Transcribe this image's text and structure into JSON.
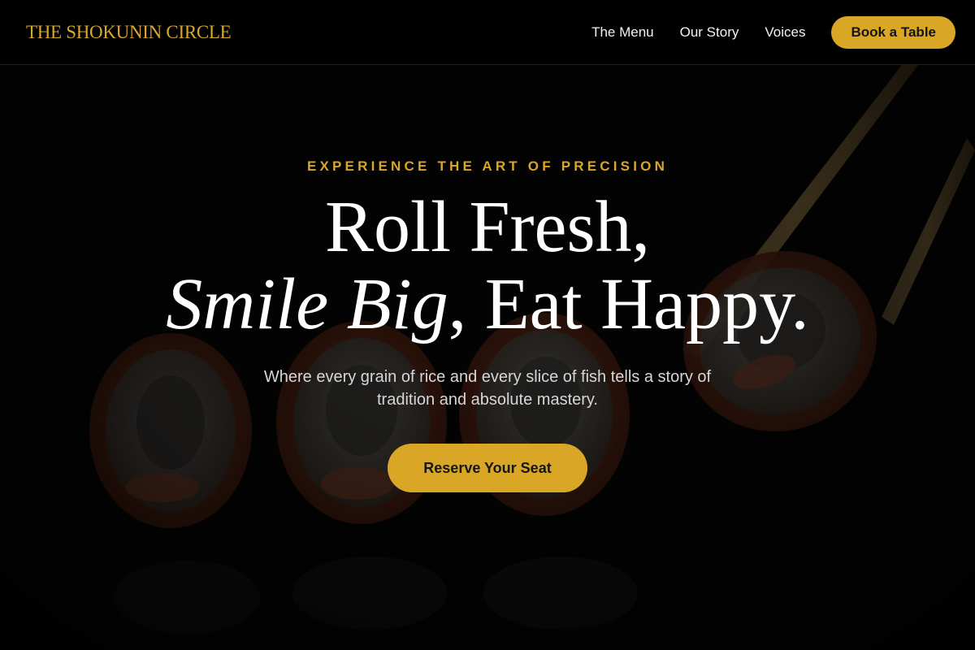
{
  "header": {
    "brand": "THE SHOKUNIN CIRCLE",
    "nav": [
      "The Menu",
      "Our Story",
      "Voices"
    ],
    "cta_label": "Book a Table"
  },
  "hero": {
    "eyebrow": "EXPERIENCE THE ART OF PRECISION",
    "headline_line1": "Roll Fresh,",
    "headline_italic": "Smile Big",
    "headline_rest": ", Eat Happy.",
    "subtext": "Where every grain of rice and every slice of fish tells a story of tradition and absolute mastery.",
    "cta_label": "Reserve Your Seat",
    "background_image": "sushi-rolls-with-chopsticks"
  },
  "colors": {
    "accent": "#d9a626",
    "brand_text": "#d8a72c",
    "background": "#000000",
    "text": "#ffffff"
  }
}
